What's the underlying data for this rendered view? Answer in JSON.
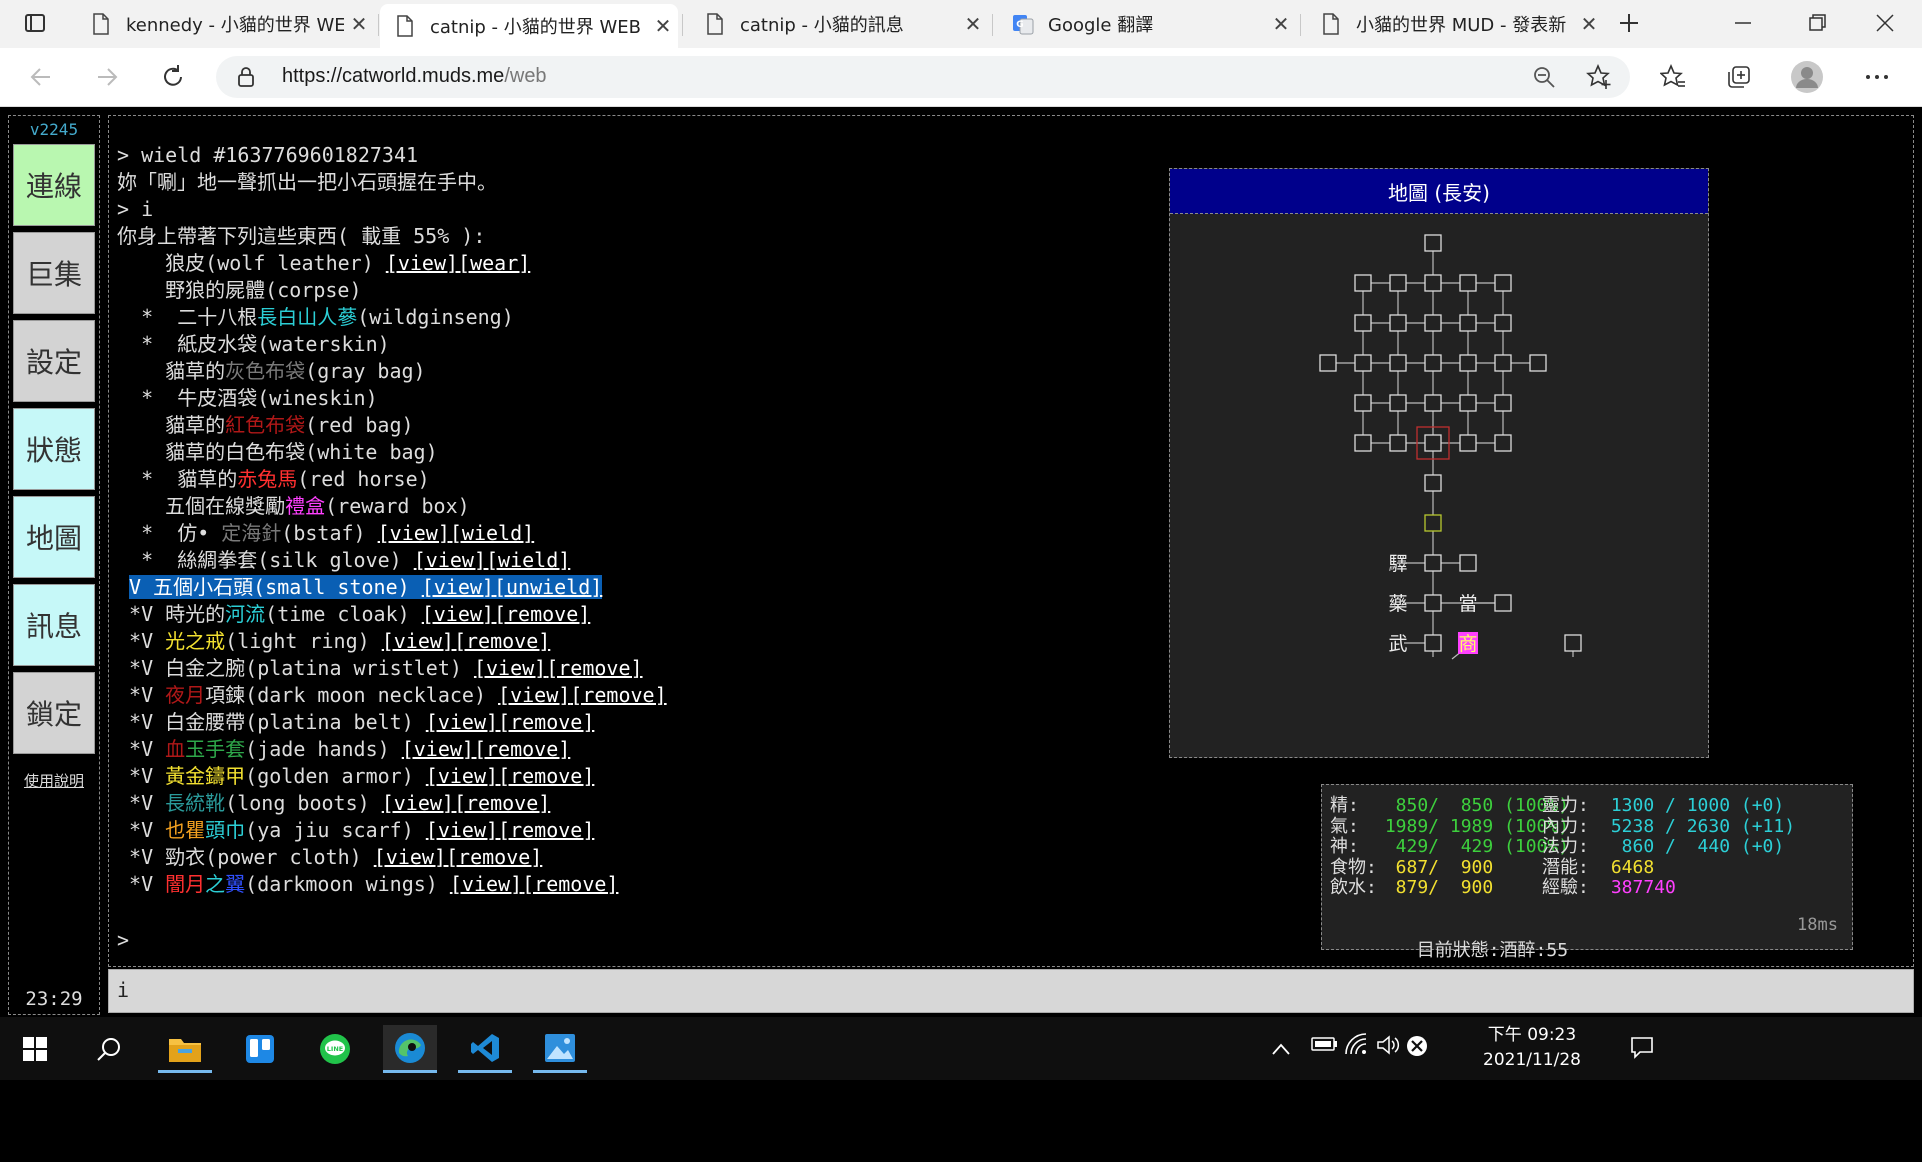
{
  "browser": {
    "tabs": [
      {
        "title": "kennedy - 小貓的世界 WE",
        "icon": "page-icon",
        "active": false
      },
      {
        "title": "catnip - 小貓的世界 WEB",
        "icon": "page-icon",
        "active": true
      },
      {
        "title": "catnip - 小貓的訊息",
        "icon": "page-icon",
        "active": false
      },
      {
        "title": "Google 翻譯",
        "icon": "google-translate-icon",
        "active": false
      },
      {
        "title": "小貓的世界 MUD - 發表新",
        "icon": "page-icon",
        "active": false
      }
    ],
    "url_host": "https://catworld.muds.me",
    "url_path": "/web"
  },
  "client": {
    "version": "v2245",
    "buttons": [
      {
        "label": "連線",
        "color": "#b9f7b0"
      },
      {
        "label": "巨集",
        "color": "#d3d3d3"
      },
      {
        "label": "設定",
        "color": "#d3d3d3"
      },
      {
        "label": "狀態",
        "color": "#c6f8f8"
      },
      {
        "label": "地圖",
        "color": "#c6f8f8"
      },
      {
        "label": "訊息",
        "color": "#c6f8f8"
      },
      {
        "label": "鎖定",
        "color": "#d3d3d3"
      }
    ],
    "help": "使用說明",
    "clock": "23:29",
    "input_value": "i",
    "final_prompt": ">"
  },
  "console": {
    "lines": [
      [
        {
          "t": "> wield #1637769601827341"
        }
      ],
      [
        {
          "t": "妳「唰」地一聲抓出一把小石頭握在手中。"
        }
      ],
      [
        {
          "t": "> i"
        }
      ],
      [
        {
          "t": "你身上帶著下列這些東西( 載重 55% ):"
        }
      ],
      [
        {
          "t": "    狼皮(wolf leather) "
        },
        {
          "t": "[view]",
          "link": true
        },
        {
          "t": "[wear]",
          "link": true
        }
      ],
      [
        {
          "t": "    野狼的屍體(corpse)"
        }
      ],
      [
        {
          "t": "  *  二十八根"
        },
        {
          "t": "長白山人蔘",
          "c": "#2ccfd6"
        },
        {
          "t": "(wildginseng)"
        }
      ],
      [
        {
          "t": "  *  紙皮水袋(waterskin)"
        }
      ],
      [
        {
          "t": "    貓草的"
        },
        {
          "t": "灰色布袋",
          "c": "#7a7a7a"
        },
        {
          "t": "(gray bag)"
        }
      ],
      [
        {
          "t": "  *  牛皮酒袋(wineskin)"
        }
      ],
      [
        {
          "t": "    貓草的"
        },
        {
          "t": "紅色布袋",
          "c": "#b01818"
        },
        {
          "t": "(red bag)"
        }
      ],
      [
        {
          "t": "    貓草的白色布袋(white bag)"
        }
      ],
      [
        {
          "t": "  *  貓草的"
        },
        {
          "t": "赤兔馬",
          "c": "#ff3030"
        },
        {
          "t": "(red horse)"
        }
      ],
      [
        {
          "t": "    五個在線獎勵"
        },
        {
          "t": "禮盒",
          "c": "#ff40ff"
        },
        {
          "t": "(reward box)"
        }
      ],
      [
        {
          "t": "  *  仿• "
        },
        {
          "t": "定海針",
          "c": "#7a7a7a"
        },
        {
          "t": "(bstaf) "
        },
        {
          "t": "[view]",
          "link": true
        },
        {
          "t": "[wield]",
          "link": true
        }
      ],
      [
        {
          "t": "  *  絲綢拳套(silk glove) "
        },
        {
          "t": "[view]",
          "link": true
        },
        {
          "t": "[wield]",
          "link": true
        }
      ],
      [
        {
          "t": " "
        },
        {
          "t": "V 五個小石頭(small stone) ",
          "hl": true
        },
        {
          "t": "[view]",
          "link": true,
          "hl": true
        },
        {
          "t": "[unwield]",
          "link": true,
          "hl": true
        }
      ],
      [
        {
          "t": " *V 時光的"
        },
        {
          "t": "河流",
          "c": "#2ccfd6"
        },
        {
          "t": "(time cloak) "
        },
        {
          "t": "[view]",
          "link": true
        },
        {
          "t": "[remove]",
          "link": true
        }
      ],
      [
        {
          "t": " *V "
        },
        {
          "t": "光之戒",
          "c": "#f2e030"
        },
        {
          "t": "(light ring) "
        },
        {
          "t": "[view]",
          "link": true
        },
        {
          "t": "[remove]",
          "link": true
        }
      ],
      [
        {
          "t": " *V 白金之腕(platina wristlet) "
        },
        {
          "t": "[view]",
          "link": true
        },
        {
          "t": "[remove]",
          "link": true
        }
      ],
      [
        {
          "t": " *V "
        },
        {
          "t": "夜月",
          "c": "#b01818"
        },
        {
          "t": "項鍊(dark moon necklace) "
        },
        {
          "t": "[view]",
          "link": true
        },
        {
          "t": "[remove]",
          "link": true
        }
      ],
      [
        {
          "t": " *V 白金腰帶(platina belt) "
        },
        {
          "t": "[view]",
          "link": true
        },
        {
          "t": "[remove]",
          "link": true
        }
      ],
      [
        {
          "t": " *V "
        },
        {
          "t": "血",
          "c": "#b01818"
        },
        {
          "t": "玉手套",
          "c": "#2ea84a"
        },
        {
          "t": "(jade hands) "
        },
        {
          "t": "[view]",
          "link": true
        },
        {
          "t": "[remove]",
          "link": true
        }
      ],
      [
        {
          "t": " *V "
        },
        {
          "t": "黃金鑄甲",
          "c": "#f2e030"
        },
        {
          "t": "(golden armor) "
        },
        {
          "t": "[view]",
          "link": true
        },
        {
          "t": "[remove]",
          "link": true
        }
      ],
      [
        {
          "t": " *V "
        },
        {
          "t": "長統靴",
          "c": "#2a9a9a"
        },
        {
          "t": "(long boots) "
        },
        {
          "t": "[view]",
          "link": true
        },
        {
          "t": "[remove]",
          "link": true
        }
      ],
      [
        {
          "t": " *V "
        },
        {
          "t": "也瞿",
          "c": "#f2a020"
        },
        {
          "t": "頭巾",
          "c": "#2ccfd6"
        },
        {
          "t": "(ya jiu scarf) "
        },
        {
          "t": "[view]",
          "link": true
        },
        {
          "t": "[remove]",
          "link": true
        }
      ],
      [
        {
          "t": " *V 勁衣(power cloth) "
        },
        {
          "t": "[view]",
          "link": true
        },
        {
          "t": "[remove]",
          "link": true
        }
      ],
      [
        {
          "t": " *V "
        },
        {
          "t": "闇月",
          "c": "#ff3030"
        },
        {
          "t": "之",
          "c": "#2ccfd6"
        },
        {
          "t": "翼",
          "c": "#3050ff"
        },
        {
          "t": "(darkmoon wings) "
        },
        {
          "t": "[view]",
          "link": true
        },
        {
          "t": "[remove]",
          "link": true
        }
      ]
    ]
  },
  "map": {
    "title": "地圖 (長安)",
    "labels": {
      "yi": "驛",
      "yao": "藥",
      "dang": "當",
      "wu": "武",
      "shang": "商"
    },
    "current_room_color": "#c03030",
    "special_room_color": "#b8c830",
    "shop_bg": "#ff40ff"
  },
  "status": {
    "rows": [
      {
        "l1": "精:",
        "v1": "  850/  850 (100%)",
        "c1": "#3dd03d",
        "l2": "靈力:",
        "v2": " 1300 / 1000 (+0)",
        "c2": "#2ccfd6"
      },
      {
        "l1": "氣:",
        "v1": " 1989/ 1989 (100%)",
        "c1": "#3dd03d",
        "l2": "內力:",
        "v2": " 5238 / 2630 (+11)",
        "c2": "#2ccfd6"
      },
      {
        "l1": "神:",
        "v1": "  429/  429 (100%)",
        "c1": "#3dd03d",
        "l2": "法力:",
        "v2": "  860 /  440 (+0)",
        "c2": "#2ccfd6"
      },
      {
        "l1": "食物:",
        "v1": "  687/  900",
        "c1": "#f2e030",
        "l2": "潛能:",
        "v2": " 6468",
        "c2": "#f2e030"
      },
      {
        "l1": "飲水:",
        "v1": "  879/  900",
        "c1": "#f2e030",
        "l2": "經驗:",
        "v2": " 387740",
        "c2": "#ff40ff"
      }
    ],
    "state_label": "目前狀態:",
    "state_value": "酒醉:55",
    "latency": "18ms"
  },
  "taskbar": {
    "apps": [
      "file-explorer-icon",
      "trello-icon",
      "line-icon",
      "edge-icon",
      "vscode-icon",
      "photos-icon"
    ],
    "time": "下午 09:23",
    "date": "2021/11/28"
  }
}
